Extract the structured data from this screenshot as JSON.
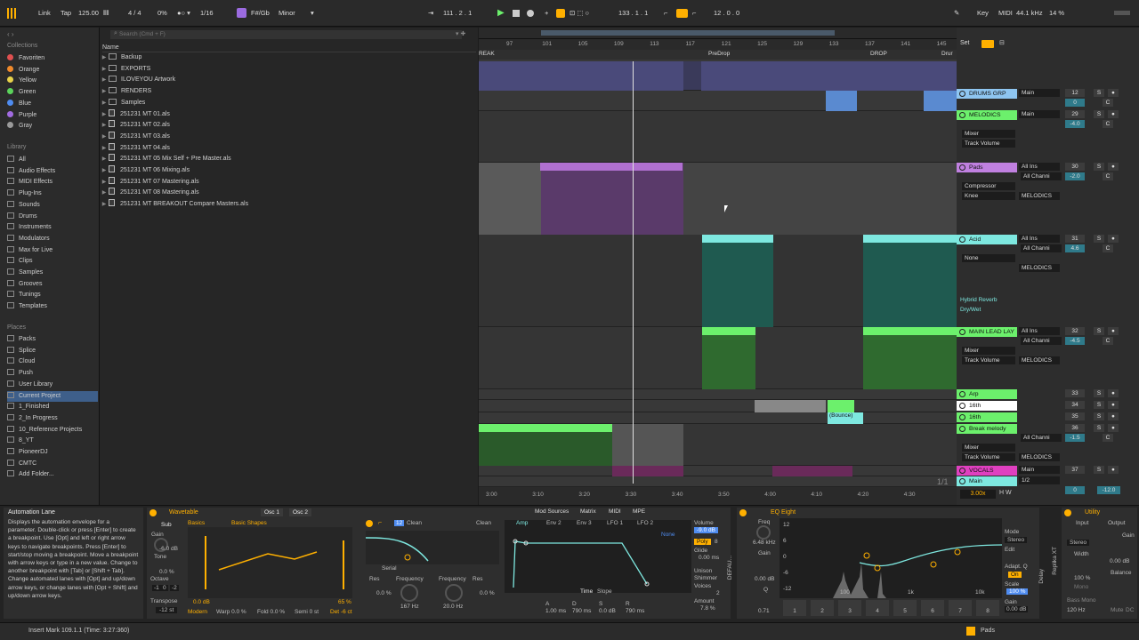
{
  "transport": {
    "link": "Link",
    "tap": "Tap",
    "tempo": "125.00",
    "meter": "4 / 4",
    "swing": "0%",
    "quant": "1/16",
    "key_label": "F#/Gb",
    "scale": "Minor",
    "position": "111 .  2 .  1",
    "loop_start": "133 .  1 .  1",
    "loop_len": "12 .  0 .  0",
    "key": "Key",
    "midi": "MIDI",
    "sample_rate": "44.1 kHz",
    "cpu": "14 %"
  },
  "browser": {
    "search_placeholder": "Search (Cmd + F)",
    "name_col": "Name",
    "collections_title": "Collections",
    "collections": [
      {
        "label": "Favoriten",
        "color": "#e05050"
      },
      {
        "label": "Orange",
        "color": "#f08a2b"
      },
      {
        "label": "Yellow",
        "color": "#e8d24a"
      },
      {
        "label": "Green",
        "color": "#5bd35b"
      },
      {
        "label": "Blue",
        "color": "#4f8cf0"
      },
      {
        "label": "Purple",
        "color": "#a16be0"
      },
      {
        "label": "Gray",
        "color": "#9a9a9a"
      }
    ],
    "library_title": "Library",
    "library": [
      "All",
      "Audio Effects",
      "MIDI Effects",
      "Plug-Ins",
      "Sounds",
      "Drums",
      "Instruments",
      "Modulators",
      "Max for Live",
      "Clips",
      "Samples",
      "Grooves",
      "Tunings",
      "Templates"
    ],
    "places_title": "Places",
    "places": [
      "Packs",
      "Splice",
      "Cloud",
      "Push",
      "User Library",
      "Current Project",
      "1_Finished",
      "2_In Progress",
      "10_Reference Projects",
      "8_YT",
      "PioneerDJ",
      "CMTC",
      "Add Folder..."
    ],
    "files": [
      {
        "name": "Backup",
        "type": "folder"
      },
      {
        "name": "EXPORTS",
        "type": "folder"
      },
      {
        "name": "ILOVEYOU Artwork",
        "type": "folder"
      },
      {
        "name": "RENDERS",
        "type": "folder"
      },
      {
        "name": "Samples",
        "type": "folder"
      },
      {
        "name": "251231 MT 01.als",
        "type": "file"
      },
      {
        "name": "251231 MT 02.als",
        "type": "file"
      },
      {
        "name": "251231 MT 03.als",
        "type": "file"
      },
      {
        "name": "251231 MT 04.als",
        "type": "file"
      },
      {
        "name": "251231 MT 05 Mix Self + Pre Master.als",
        "type": "file"
      },
      {
        "name": "251231 MT 06 Mixing.als",
        "type": "file"
      },
      {
        "name": "251231 MT 07 Mastering.als",
        "type": "file"
      },
      {
        "name": "251231 MT 08 Mastering.als",
        "type": "file"
      },
      {
        "name": "251231 MT BREAKOUT Compare Masters.als",
        "type": "file"
      }
    ]
  },
  "arrangement": {
    "bars": [
      "97",
      "101",
      "105",
      "109",
      "113",
      "117",
      "121",
      "125",
      "129",
      "133",
      "137",
      "141",
      "145"
    ],
    "locators": [
      "REAK",
      "PreDrop",
      "DROP",
      "Drur"
    ],
    "times": [
      "3:00",
      "3:10",
      "3:20",
      "3:30",
      "3:40",
      "3:50",
      "4:00",
      "4:10",
      "4:20",
      "4:30"
    ],
    "set": "Set",
    "page": "1/1",
    "zoom": "3.00x",
    "bounce": "(Bounce)"
  },
  "tracks": [
    {
      "name": "DRUMS GRP",
      "color": "#8ec5f0",
      "in": "Main",
      "vol": "12",
      "num2": "0",
      "send": "C"
    },
    {
      "name": "MELODICS",
      "color": "#6cf06c",
      "in": "Main",
      "vol": "29",
      "num2": "-4.0",
      "send": "C",
      "dev1": "Mixer",
      "dev2": "Track Volume"
    },
    {
      "name": "Pads",
      "color": "#c080e0",
      "in": "All Ins",
      "ch": "All Channi",
      "vol": "30",
      "num2": "-2.0",
      "send": "C",
      "dev1": "Compressor",
      "dev2": "Knee",
      "route": "MELODICS"
    },
    {
      "name": "Acid",
      "color": "#7ee8e0",
      "in": "All Ins",
      "ch": "All Channi",
      "vol": "31",
      "num2": "4.6",
      "send": "C",
      "dev1": "None",
      "route": "MELODICS",
      "extra1": "Hybrid Reverb",
      "extra2": "Dry/Wet"
    },
    {
      "name": "MAIN LEAD LAY",
      "color": "#6cf06c",
      "in": "All Ins",
      "ch": "All Channi",
      "vol": "32",
      "num2": "-4.5",
      "send": "C",
      "dev1": "Mixer",
      "dev2": "Track Volume",
      "route": "MELODICS"
    },
    {
      "name": "Arp",
      "color": "#6cf06c",
      "vol": "33"
    },
    {
      "name": "16th",
      "color": "#ffffff",
      "vol": "34"
    },
    {
      "name": "16th",
      "color": "#6cf06c",
      "vol": "35"
    },
    {
      "name": "Break melody",
      "color": "#6cf06c",
      "ch": "All Channi",
      "vol": "36",
      "num2": "-1.5",
      "send": "C",
      "dev1": "Mixer",
      "dev2": "Track Volume",
      "route": "MELODICS"
    },
    {
      "name": "VOCALS",
      "color": "#e040c0",
      "in": "Main",
      "vol": "37"
    },
    {
      "name": "Main",
      "color": "#7ee8e0",
      "in": "1/2",
      "num2": "0",
      "num3": "-12.0"
    }
  ],
  "info": {
    "title": "Automation Lane",
    "text": "Displays the automation envelope for a parameter. Double-click or press [Enter] to create a breakpoint. Use [Opt] and left or right arrow keys to navigate breakpoints. Press [Enter] to start/stop moving a breakpoint. Move a breakpoint with arrow keys or type in a new value. Change to another breakpoint with [Tab] or [Shift + Tab]. Change automated lanes with [Opt] and up/down arrow keys, or change lanes with [Opt + Shift] and up/down arrow keys."
  },
  "wavetable": {
    "title": "Wavetable",
    "osc1": "Osc 1",
    "osc2": "Osc 2",
    "sub": "Sub",
    "gain": "Gain",
    "gain_val": "-6.0 dB",
    "tone": "Tone",
    "tone_val": "0.0 %",
    "octave": "Octave",
    "oct_vals": [
      "-1",
      "0",
      "-2"
    ],
    "transpose": "Transpose",
    "transpose_val": "-12 st",
    "basics": "Basics",
    "basic_shapes": "Basic Shapes",
    "osc_c": "C",
    "osc_gain": "0.0 dB",
    "osc_pct": "65 %",
    "modern": "Modern",
    "warp": "Warp 0.0 %",
    "fold": "Fold 0.0 %",
    "semi": "Semi 0 st",
    "det": "Det -6 ct",
    "f1_num": "12",
    "clean1": "Clean",
    "clean2": "Clean",
    "serial": "Serial",
    "res1": "Res",
    "res1_val": "0.0 %",
    "freq1": "Frequency",
    "freq1_val": "167 Hz",
    "freq2": "Frequency",
    "freq2_val": "20.0 Hz",
    "res2": "Res",
    "res2_val": "0.0 %",
    "tabs": [
      "Mod Sources",
      "Matrix",
      "MIDI",
      "MPE"
    ],
    "env": [
      "Amp",
      "Env 2",
      "Env 3",
      "LFO 1",
      "LFO 2"
    ],
    "none": "None",
    "time": "Time",
    "slope": "Slope",
    "adsr_l": [
      "A",
      "D",
      "S",
      "R"
    ],
    "adsr_v": [
      "1.00 ms",
      "790 ms",
      "0.0 dB",
      "790 ms"
    ],
    "volume": "Volume",
    "volume_val": "-9.0 dB",
    "poly": "Poly",
    "voices_num": "8",
    "glide": "Glide",
    "glide_val": "0.00 ms",
    "unison": "Unison",
    "shimmer": "Shimmer",
    "voices": "Voices",
    "voices_val": "2",
    "amount": "Amount",
    "amount_val": "7.8 %",
    "default": "DEFAU..."
  },
  "eq": {
    "title": "EQ Eight",
    "freq": "Freq",
    "freq_val": "6.48 kHz",
    "gain": "Gain",
    "gain_val": "0.00 dB",
    "q": "Q",
    "q_val": "0.71",
    "db": [
      "12",
      "6",
      "0",
      "-6",
      "-12"
    ],
    "hz": [
      "100",
      "1k",
      "10k"
    ],
    "mode": "Mode",
    "mode_val": "Stereo",
    "edit": "Edit",
    "adaptq": "Adapt. Q",
    "on": "On",
    "scale": "Scale",
    "scale_val": "100 %",
    "outgain": "Gain",
    "outgain_val": "0.00 dB",
    "bands": [
      "1",
      "2",
      "3",
      "4",
      "5",
      "6",
      "7",
      "8"
    ],
    "replika": "Replika XT",
    "delay": "Delay"
  },
  "utility": {
    "title": "Utility",
    "input": "Input",
    "output": "Output",
    "gain": "Gain",
    "stereo": "Stereo",
    "width": "Width",
    "width_val": "100 %",
    "mono": "Mono",
    "bass_mono": "Bass Mono",
    "bass_freq": "120 Hz",
    "balance": "Balance",
    "db_val": "0.00 dB",
    "mute": "Mute",
    "dc": "DC"
  },
  "status": {
    "text": "Insert Mark 109.1.1 (Time: 3:27:360)",
    "pads": "Pads"
  }
}
